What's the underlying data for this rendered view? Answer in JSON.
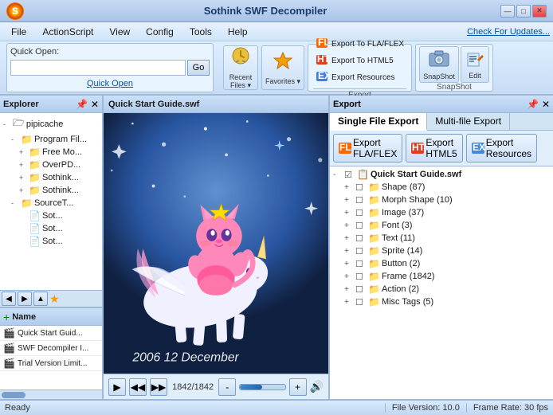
{
  "titleBar": {
    "title": "Sothink SWF Decompiler",
    "logo": "S",
    "controls": [
      "—",
      "□",
      "✕"
    ]
  },
  "menuBar": {
    "items": [
      "File",
      "ActionScript",
      "View",
      "Config",
      "Tools",
      "Help"
    ],
    "checkUpdates": "Check For Updates..."
  },
  "toolbar": {
    "quickOpen": {
      "label": "Quick Open:",
      "placeholder": "",
      "goBtn": "Go",
      "linkLabel": "Quick Open"
    },
    "recentFiles": "Recent\nFiles▾",
    "favorites": "Favorites▾",
    "exportGroup": {
      "title": "Export",
      "items": [
        {
          "icon": "📤",
          "label": "Export To FLA/FLEX"
        },
        {
          "icon": "📤",
          "label": "Export To HTML5"
        },
        {
          "icon": "📦",
          "label": "Export Resources"
        }
      ]
    },
    "snapshot": {
      "title": "SnapShot",
      "snapBtn": "SnapShot",
      "editBtn": "Edit"
    }
  },
  "explorer": {
    "title": "Explorer",
    "tree": [
      {
        "label": "pipicache",
        "indent": 0,
        "type": "folder",
        "expand": "-"
      },
      {
        "label": "Program Fil...",
        "indent": 1,
        "type": "folder",
        "expand": "-"
      },
      {
        "label": "Free Mo...",
        "indent": 2,
        "type": "folder",
        "expand": "+"
      },
      {
        "label": "OverPD...",
        "indent": 2,
        "type": "folder",
        "expand": "+"
      },
      {
        "label": "Sothink...",
        "indent": 2,
        "type": "folder",
        "expand": "+"
      },
      {
        "label": "Sothink...",
        "indent": 2,
        "type": "folder",
        "expand": "+"
      },
      {
        "label": "SourceT...",
        "indent": 1,
        "type": "folder",
        "expand": "-"
      },
      {
        "label": "Sot...",
        "indent": 2,
        "type": "file"
      },
      {
        "label": "Sot...",
        "indent": 2,
        "type": "file"
      },
      {
        "label": "Sot...",
        "indent": 2,
        "type": "file"
      }
    ]
  },
  "files": {
    "title": "Name",
    "items": [
      {
        "label": "Quick Start Guid..."
      },
      {
        "label": "SWF Decompiler I..."
      },
      {
        "label": "Trial Version Limit..."
      }
    ]
  },
  "preview": {
    "title": "Quick Start Guide.swf",
    "frame": "1842/1842",
    "date": "2006 12 December"
  },
  "exportPanel": {
    "title": "Export",
    "tabs": [
      "Single File Export",
      "Multi-file Export"
    ],
    "activeTab": 0,
    "exportButtons": [
      {
        "icon": "📤",
        "label": "Export\nFLA/FLEX"
      },
      {
        "icon": "📤",
        "label": "Export\nHTML5"
      },
      {
        "icon": "📦",
        "label": "Export\nResources"
      }
    ],
    "tree": {
      "root": "Quick Start Guide.swf",
      "items": [
        {
          "label": "Shape (87)",
          "indent": 1
        },
        {
          "label": "Morph Shape (10)",
          "indent": 1
        },
        {
          "label": "Image (37)",
          "indent": 1
        },
        {
          "label": "Font (3)",
          "indent": 1
        },
        {
          "label": "Text (11)",
          "indent": 1
        },
        {
          "label": "Sprite (14)",
          "indent": 1
        },
        {
          "label": "Button (2)",
          "indent": 1
        },
        {
          "label": "Frame (1842)",
          "indent": 1
        },
        {
          "label": "Action (2)",
          "indent": 1
        },
        {
          "label": "Misc Tags (5)",
          "indent": 1
        }
      ]
    }
  },
  "statusBar": {
    "ready": "Ready",
    "fileVersion": "File Version: 10.0",
    "frameRate": "Frame Rate: 30 fps"
  }
}
